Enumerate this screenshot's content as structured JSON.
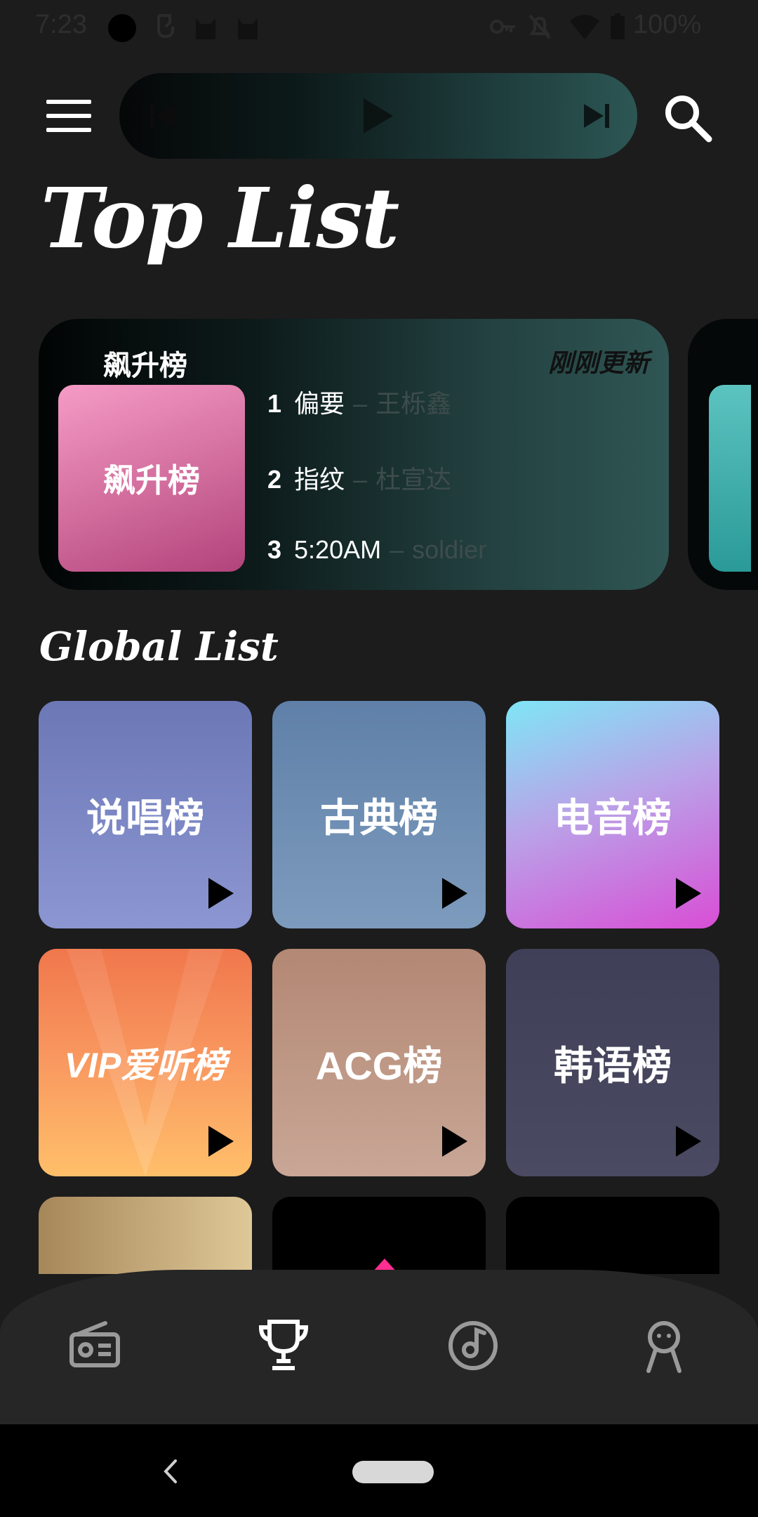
{
  "status_bar": {
    "time": "7:23",
    "battery": "100%"
  },
  "header": {
    "title": "Top List",
    "icons": [
      "menu-icon",
      "previous-icon",
      "play-icon",
      "next-icon",
      "search-icon"
    ]
  },
  "featured": {
    "calligraphy_title": "飙升榜",
    "update_note": "刚刚更新",
    "cover_title": "飙升榜",
    "songs": [
      {
        "rank": "1",
        "title": "偏要",
        "sep": "–",
        "artist": "王栎鑫"
      },
      {
        "rank": "2",
        "title": "指纹",
        "sep": "–",
        "artist": "杜宣达"
      },
      {
        "rank": "3",
        "title": "5:20AM",
        "sep": "–",
        "artist": "soldier"
      }
    ]
  },
  "global": {
    "title": "Global List",
    "tiles": [
      {
        "name": "说唱榜"
      },
      {
        "name": "古典榜"
      },
      {
        "name": "电音榜"
      },
      {
        "name": "VIP爱听榜"
      },
      {
        "name": "ACG榜"
      },
      {
        "name": "韩语榜"
      }
    ]
  },
  "bottom_nav": {
    "items": [
      "radio-icon",
      "trophy-icon",
      "music-disc-icon",
      "profile-icon"
    ],
    "active_index": 1
  },
  "colors": {
    "background": "#1c1c1c",
    "nav_bg": "#262626",
    "feature_cover": "#d16c9c"
  }
}
